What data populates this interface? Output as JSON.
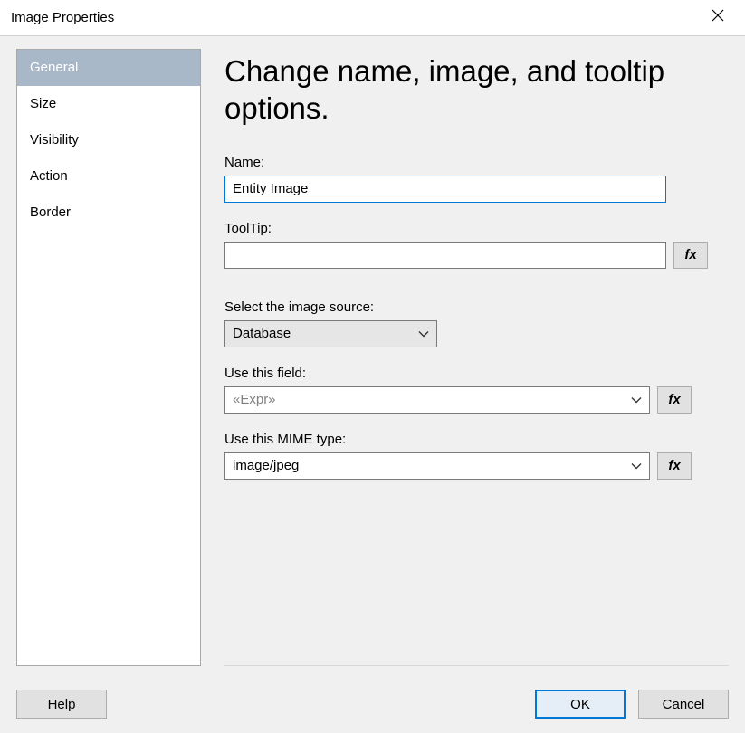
{
  "title": "Image Properties",
  "sidebar": {
    "items": [
      {
        "label": "General",
        "selected": true
      },
      {
        "label": "Size"
      },
      {
        "label": "Visibility"
      },
      {
        "label": "Action"
      },
      {
        "label": "Border"
      }
    ]
  },
  "main": {
    "heading": "Change name, image, and tooltip options.",
    "name_label": "Name:",
    "name_value": "Entity Image",
    "tooltip_label": "ToolTip:",
    "tooltip_value": "",
    "source_label": "Select the image source:",
    "source_value": "Database",
    "field_label": "Use this field:",
    "field_value": "«Expr»",
    "mime_label": "Use this MIME type:",
    "mime_value": "image/jpeg",
    "fx_label": "fx"
  },
  "footer": {
    "help": "Help",
    "ok": "OK",
    "cancel": "Cancel"
  }
}
